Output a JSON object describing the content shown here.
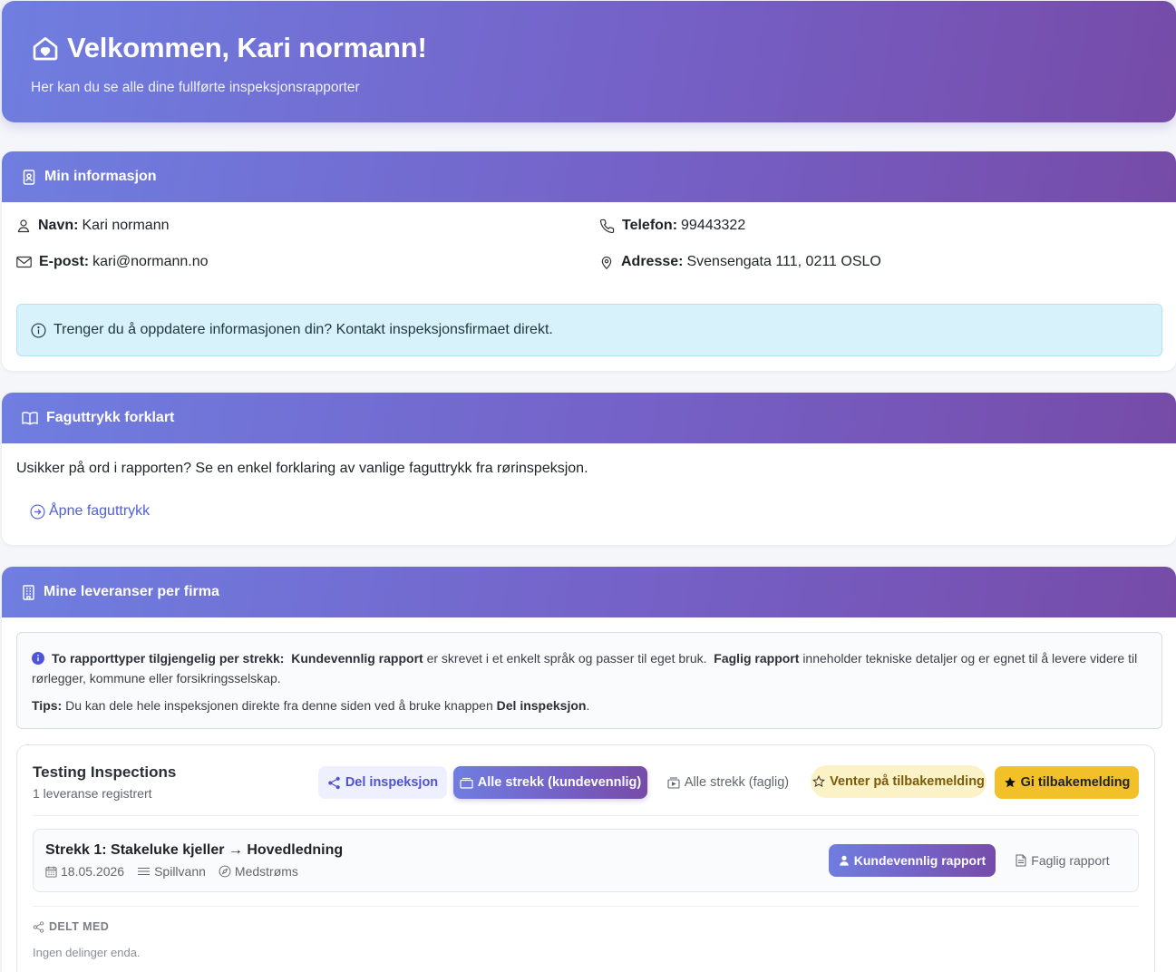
{
  "hero": {
    "title": "Velkommen, Kari normann!",
    "subtitle": "Her kan du se alle dine fullførte inspeksjonsrapporter",
    "icon": "home-heart-icon"
  },
  "info_card": {
    "title": "Min informasjon",
    "name_label": "Navn:",
    "name_value": "Kari normann",
    "email_label": "E-post:",
    "email_value": "kari@normann.no",
    "phone_label": "Telefon:",
    "phone_value": "99443322",
    "address_label": "Adresse:",
    "address_value": "Svensengata 111, 0211 OSLO",
    "alert_text": "Trenger du å oppdatere informasjonen din? Kontakt inspeksjonsfirmaet direkt."
  },
  "terms_card": {
    "title": "Faguttrykk forklart",
    "text": "Usikker på ord i rapporten? Se en enkel forklaring av vanlige faguttrykk fra rørinspeksjon.",
    "link": "Åpne faguttrykk"
  },
  "deliveries_card": {
    "title": "Mine leveranser per firma",
    "notice": {
      "lead": "To rapporttyper tilgjengelig per strekk:",
      "kunde_label": "Kundevennlig rapport",
      "kunde_text": "er skrevet i et enkelt språk og passer til eget bruk.",
      "faglig_label": "Faglig rapport",
      "faglig_text": "inneholder tekniske detaljer og er egnet til å levere videre til rørlegger, kommune eller forsikringsselskap.",
      "tips_label": "Tips:",
      "tips_text": "Du kan dele hele inspeksjonen direkte fra denne siden ved å bruke knappen",
      "tips_button": "Del inspeksjon",
      "tips_end": "."
    },
    "firm": {
      "name": "Testing Inspections",
      "count": "1 leveranse registrert",
      "buttons": {
        "share": "Del inspeksjon",
        "all_kunde": "Alle strekk (kundevennlig)",
        "all_faglig": "Alle strekk (faglig)",
        "pending": "Venter på tilbakemelding",
        "feedback": "Gi tilbakemelding"
      },
      "strekk": {
        "title": "Strekk 1: Stakeluke kjeller → Hovedledning",
        "date": "18.05.2026",
        "type": "Spillvann",
        "direction": "Medstrøms",
        "kunde_button": "Kundevennlig rapport",
        "faglig_button": "Faglig rapport"
      },
      "shared_label": "DELT MED",
      "shared_empty": "Ingen delinger enda."
    }
  },
  "colors": {
    "gradient_start": "#6f7ee0",
    "gradient_end": "#764ba8",
    "link": "#4f60d8",
    "feedback": "#f2c029",
    "pending_bg": "#fbf2c8",
    "alert_bg": "#d7f2fb"
  }
}
